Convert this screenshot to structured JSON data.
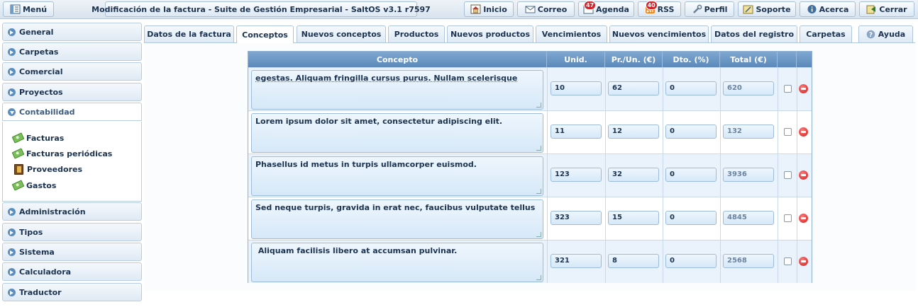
{
  "topbar": {
    "menu_label": "Menú",
    "title": "Modificación de la factura - Suite de Gestión Empresarial - SaltOS v3.1 r7597",
    "buttons": {
      "inicio": "Inicio",
      "correo": "Correo",
      "agenda": "Agenda",
      "agenda_badge": "47",
      "rss": "RSS",
      "rss_badge": "40",
      "perfil": "Perfil",
      "soporte": "Soporte",
      "acerca": "Acerca",
      "cerrar": "Cerrar"
    }
  },
  "sidebar": {
    "items": [
      "General",
      "Carpetas",
      "Comercial",
      "Proyectos",
      "Contabilidad",
      "Administración",
      "Tipos",
      "Sistema",
      "Calculadora",
      "Traductor"
    ],
    "active_index": 4,
    "subitems": [
      "Facturas",
      "Facturas periódicas",
      "Proveedores",
      "Gastos"
    ]
  },
  "tabs": [
    "Datos de la factura",
    "Conceptos",
    "Nuevos conceptos",
    "Productos",
    "Nuevos productos",
    "Vencimientos",
    "Nuevos vencimientos",
    "Datos del registro",
    "Carpetas",
    "Ayuda"
  ],
  "active_tab": "Conceptos",
  "table": {
    "headers": [
      "Concepto",
      "Unid.",
      "Pr./Un. (€)",
      "Dto. (%)",
      "Total (€)"
    ],
    "rows": [
      {
        "concepto": "egestas. Aliquam fringilla cursus purus. Nullam scelerisque",
        "unid": "10",
        "precio": "62",
        "dto": "0",
        "total": "620"
      },
      {
        "concepto": "Lorem ipsum dolor sit amet, consectetur adipiscing elit.",
        "unid": "11",
        "precio": "12",
        "dto": "0",
        "total": "132"
      },
      {
        "concepto": "Phasellus id metus in turpis ullamcorper euismod.",
        "unid": "123",
        "precio": "32",
        "dto": "0",
        "total": "3936"
      },
      {
        "concepto": "Sed neque turpis, gravida in erat nec, faucibus vulputate tellus",
        "unid": "323",
        "precio": "15",
        "dto": "0",
        "total": "4845"
      },
      {
        "concepto": " Aliquam facilisis libero at accumsan pulvinar.",
        "unid": "321",
        "precio": "8",
        "dto": "0",
        "total": "2568"
      }
    ]
  },
  "colors": {
    "header_blue": "#5b89ba",
    "row_alt": "#eaf3fb",
    "delete_red": "#d31e1e",
    "text": "#1b3350"
  }
}
